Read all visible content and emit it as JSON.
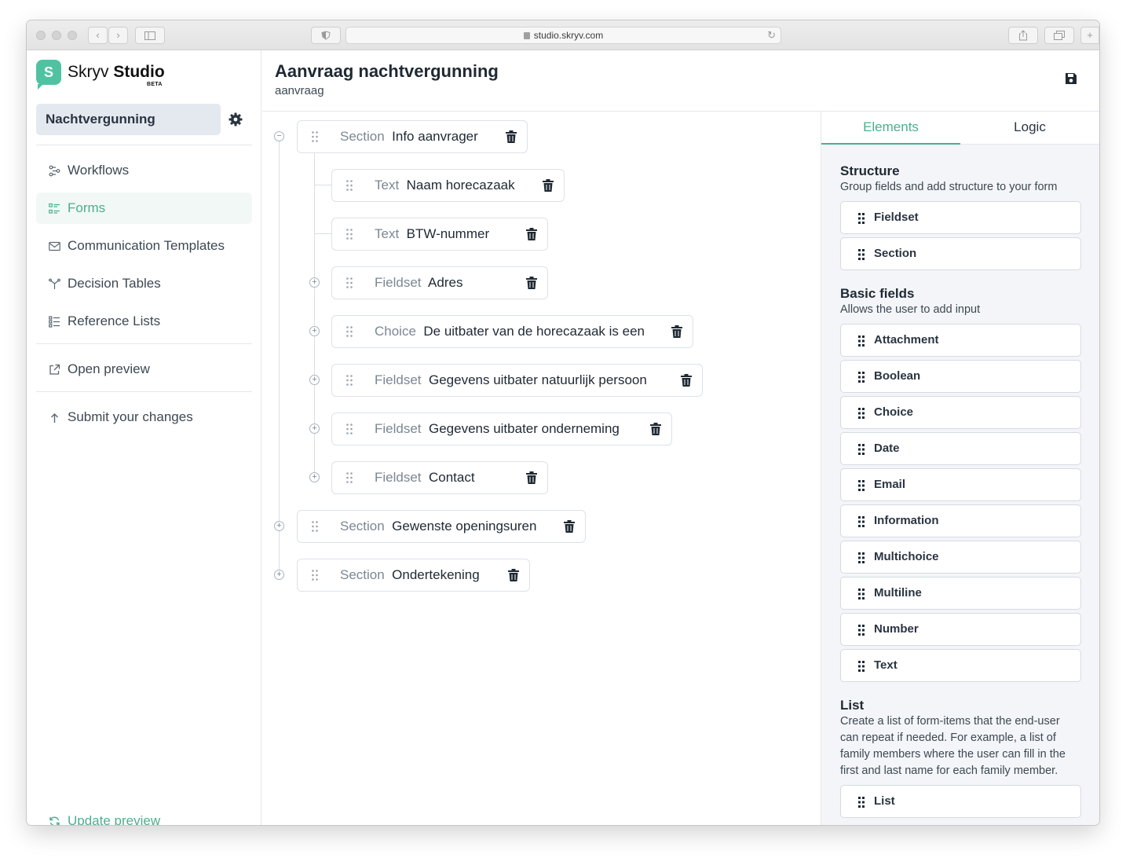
{
  "browser": {
    "url": "studio.skryv.com"
  },
  "sidebar": {
    "logo": {
      "mark": "S",
      "name_light": "Skryv",
      "name_bold": "Studio",
      "badge": "BETA"
    },
    "project": "Nachtvergunning",
    "items": [
      {
        "label": "Workflows",
        "icon": "workflow-icon",
        "active": false
      },
      {
        "label": "Forms",
        "icon": "form-icon",
        "active": true
      },
      {
        "label": "Communication Templates",
        "icon": "envelope-icon",
        "active": false
      },
      {
        "label": "Decision Tables",
        "icon": "decision-icon",
        "active": false
      },
      {
        "label": "Reference Lists",
        "icon": "list-icon",
        "active": false
      }
    ],
    "open_preview": "Open preview",
    "submit_changes": "Submit your changes",
    "update_preview": "Update preview"
  },
  "header": {
    "title": "Aanvraag nachtvergunning",
    "subtitle": "aanvraag"
  },
  "tree": [
    {
      "type": "Section",
      "label": "Info aanvrager",
      "expanded": true
    },
    {
      "type": "Text",
      "label": "Naam horecazaak"
    },
    {
      "type": "Text",
      "label": "BTW-nummer"
    },
    {
      "type": "Fieldset",
      "label": "Adres"
    },
    {
      "type": "Choice",
      "label": "De uitbater van de horecazaak is een"
    },
    {
      "type": "Fieldset",
      "label": "Gegevens uitbater natuurlijk persoon"
    },
    {
      "type": "Fieldset",
      "label": "Gegevens uitbater onderneming"
    },
    {
      "type": "Fieldset",
      "label": "Contact"
    },
    {
      "type": "Section",
      "label": "Gewenste openingsuren",
      "expanded": false
    },
    {
      "type": "Section",
      "label": "Ondertekening",
      "expanded": false
    }
  ],
  "panel": {
    "tabs": [
      "Elements",
      "Logic"
    ],
    "structure": {
      "title": "Structure",
      "desc": "Group fields and add structure to your form",
      "items": [
        "Fieldset",
        "Section"
      ]
    },
    "basic": {
      "title": "Basic fields",
      "desc": "Allows the user to add input",
      "items": [
        "Attachment",
        "Boolean",
        "Choice",
        "Date",
        "Email",
        "Information",
        "Multichoice",
        "Multiline",
        "Number",
        "Text"
      ]
    },
    "list": {
      "title": "List",
      "desc": "Create a list of form-items that the end-user can repeat if needed. For example, a list of family members where the user can fill in the first and last name for each family member.",
      "items": [
        "List"
      ]
    }
  },
  "colors": {
    "accent": "#4caf8e",
    "logo": "#4fc3a1"
  }
}
